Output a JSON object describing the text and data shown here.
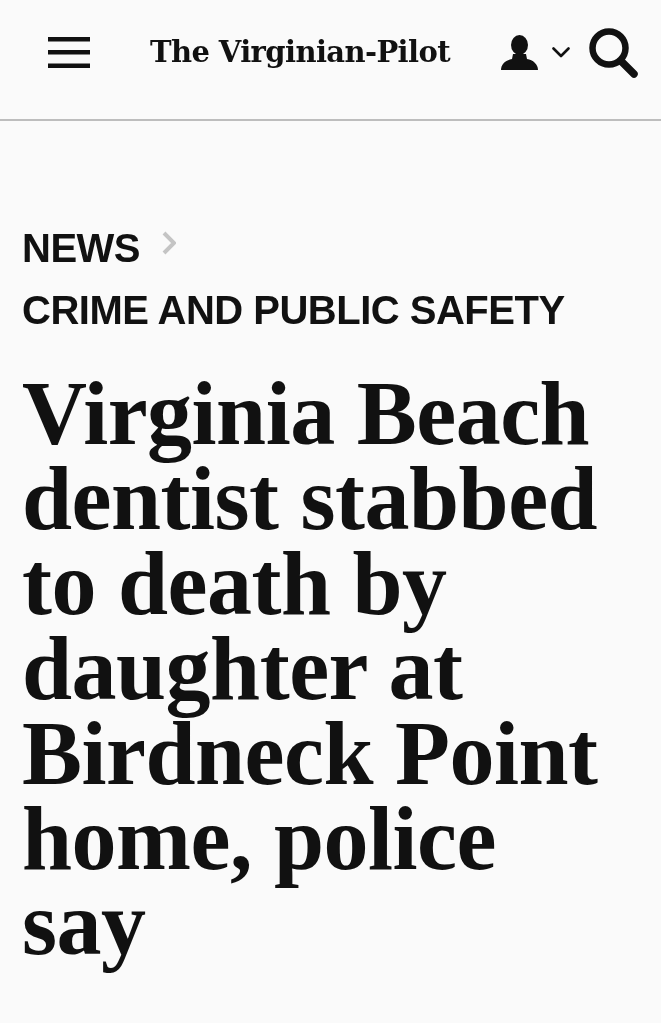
{
  "header": {
    "logo": "The Virginian-Pilot"
  },
  "breadcrumb": [
    {
      "label": "NEWS"
    },
    {
      "label": "CRIME AND PUBLIC SAFETY"
    }
  ],
  "headline": "Virginia Beach dentist stabbed to death by daughter at Birdneck Point home, police say"
}
